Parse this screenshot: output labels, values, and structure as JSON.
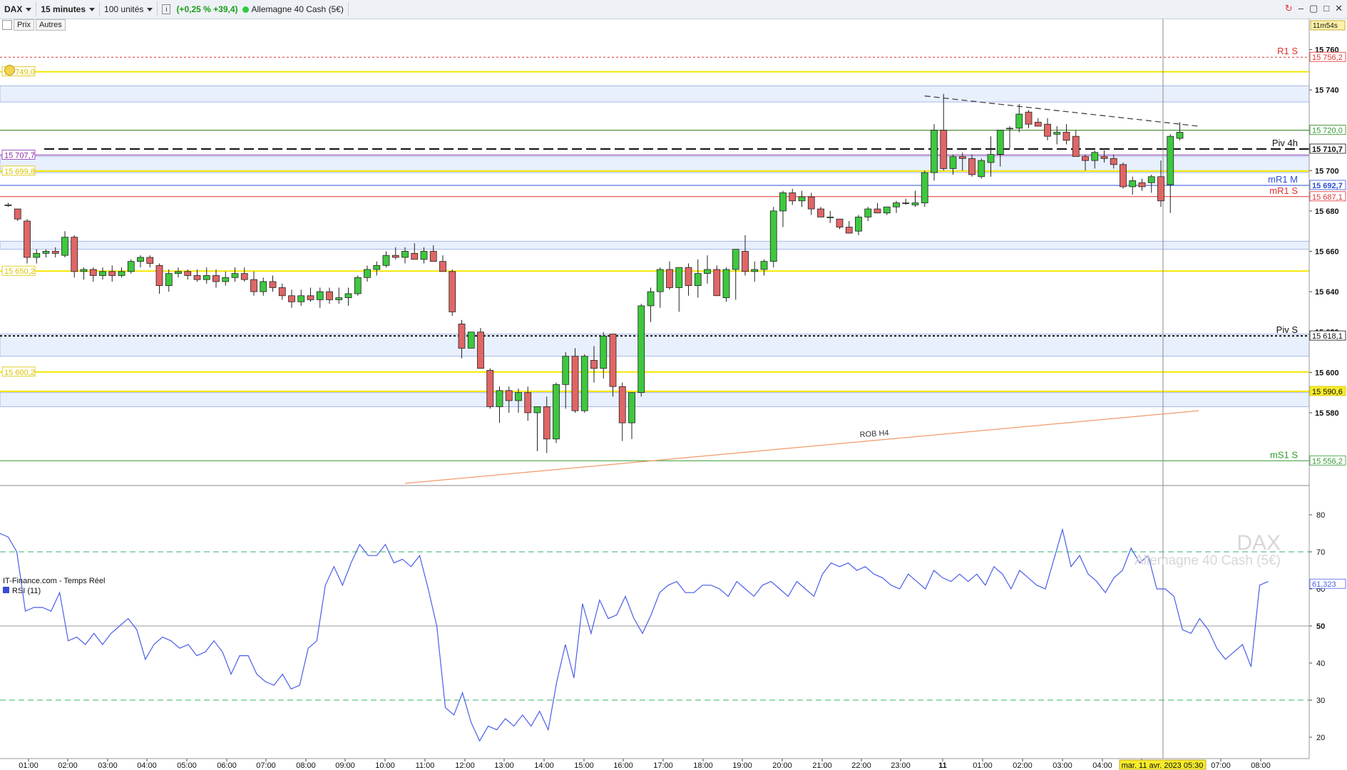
{
  "toolbar": {
    "symbol": "DAX",
    "timeframe": "15 minutes",
    "units": "100 unités",
    "info_icon": "info-icon",
    "change": "(+0,25 % +39,4)",
    "instrument": "Allemagne 40 Cash (5€)",
    "window_controls": [
      "refresh-icon",
      "minimize-icon",
      "restore-icon",
      "maximize-icon",
      "close-icon"
    ]
  },
  "subbar": {
    "prix": "Prix",
    "autres": "Autres"
  },
  "colors": {
    "up": "#3ec83e",
    "down": "#e06666",
    "yellow_line": "#f2e600",
    "blue_zone": "#e8f0fd",
    "red_line": "#e03030",
    "green_line": "#2f9a2f",
    "purple_line": "#8a2fa8",
    "rsi_line": "#4a5ee8"
  },
  "chart_data": [
    {
      "type": "candlestick",
      "title": "DAX",
      "watermark": [
        "DAX",
        "Allemagne 40 Cash (5€)"
      ],
      "source": "IT-Finance.com - Temps Réel",
      "countdown": "11m54s",
      "x_ticks": [
        "01:00",
        "02:00",
        "03:00",
        "04:00",
        "05:00",
        "06:00",
        "07:00",
        "08:00",
        "09:00",
        "10:00",
        "11:00",
        "12:00",
        "13:00",
        "14:00",
        "15:00",
        "16:00",
        "17:00",
        "18:00",
        "19:00",
        "20:00",
        "21:00",
        "22:00",
        "23:00",
        "11",
        "01:00",
        "02:00",
        "03:00",
        "04:00",
        "05:00",
        "07:00",
        "08:00"
      ],
      "crosshair_time": "mar. 11 avr. 2023 05:30",
      "y_ticks": [
        15580,
        15600,
        15620,
        15640,
        15660,
        15680,
        15700,
        15720,
        15740,
        15760
      ],
      "y_tick_labels": [
        "15 580",
        "15 600",
        "15 620",
        "15 640",
        "15 660",
        "15 680",
        "15 700",
        "15 720",
        "15 740",
        "15 760"
      ],
      "ylim": [
        15545,
        15775
      ],
      "candles": [
        [
          15683,
          15684,
          15682,
          15683
        ],
        [
          15681,
          15681,
          15675,
          15676
        ],
        [
          15675,
          15676,
          15654,
          15657
        ],
        [
          15657,
          15661,
          15654,
          15659
        ],
        [
          15659,
          15661,
          15657,
          15660
        ],
        [
          15660,
          15662,
          15657,
          15659
        ],
        [
          15658,
          15670,
          15657,
          15667
        ],
        [
          15667,
          15668,
          15647,
          15650
        ],
        [
          15650,
          15652,
          15646,
          15651
        ],
        [
          15651,
          15652,
          15645,
          15648
        ],
        [
          15648,
          15652,
          15646,
          15650
        ],
        [
          15650,
          15653,
          15645,
          15648
        ],
        [
          15648,
          15652,
          15647,
          15650
        ],
        [
          15650,
          15656,
          15649,
          15655
        ],
        [
          15655,
          15658,
          15652,
          15657
        ],
        [
          15657,
          15658,
          15652,
          15654
        ],
        [
          15653,
          15654,
          15639,
          15643
        ],
        [
          15643,
          15651,
          15640,
          15649
        ],
        [
          15649,
          15652,
          15647,
          15650
        ],
        [
          15650,
          15651,
          15646,
          15648
        ],
        [
          15648,
          15651,
          15645,
          15646
        ],
        [
          15646,
          15652,
          15644,
          15648
        ],
        [
          15648,
          15651,
          15642,
          15645
        ],
        [
          15645,
          15650,
          15643,
          15647
        ],
        [
          15647,
          15652,
          15645,
          15649
        ],
        [
          15649,
          15652,
          15645,
          15646
        ],
        [
          15646,
          15650,
          15638,
          15640
        ],
        [
          15640,
          15647,
          15638,
          15645
        ],
        [
          15645,
          15648,
          15640,
          15642
        ],
        [
          15642,
          15644,
          15636,
          15638
        ],
        [
          15638,
          15641,
          15632,
          15635
        ],
        [
          15635,
          15641,
          15633,
          15638
        ],
        [
          15638,
          15642,
          15635,
          15636
        ],
        [
          15636,
          15642,
          15632,
          15640
        ],
        [
          15640,
          15642,
          15634,
          15636
        ],
        [
          15636,
          15642,
          15634,
          15637
        ],
        [
          15637,
          15642,
          15633,
          15639
        ],
        [
          15639,
          15648,
          15638,
          15647
        ],
        [
          15647,
          15653,
          15645,
          15651
        ],
        [
          15651,
          15655,
          15648,
          15653
        ],
        [
          15653,
          15660,
          15652,
          15658
        ],
        [
          15658,
          15662,
          15656,
          15657
        ],
        [
          15657,
          15662,
          15654,
          15660
        ],
        [
          15659,
          15664,
          15656,
          15656
        ],
        [
          15656,
          15662,
          15654,
          15660
        ],
        [
          15660,
          15663,
          15656,
          15655
        ],
        [
          15655,
          15658,
          15650,
          15650
        ],
        [
          15650,
          15651,
          15628,
          15630
        ],
        [
          15624,
          15626,
          15607,
          15612
        ],
        [
          15612,
          15620,
          15612,
          15620
        ],
        [
          15620,
          15622,
          15608,
          15602
        ],
        [
          15601,
          15602,
          15582,
          15583
        ],
        [
          15583,
          15593,
          15575,
          15591
        ],
        [
          15591,
          15593,
          15580,
          15586
        ],
        [
          15586,
          15592,
          15580,
          15590
        ],
        [
          15590,
          15593,
          15576,
          15580
        ],
        [
          15580,
          15582,
          15561,
          15583
        ],
        [
          15583,
          15588,
          15560,
          15567
        ],
        [
          15567,
          15595,
          15565,
          15594
        ],
        [
          15594,
          15610,
          15582,
          15608
        ],
        [
          15608,
          15612,
          15580,
          15581
        ],
        [
          15581,
          15609,
          15580,
          15608
        ],
        [
          15606,
          15613,
          15595,
          15602
        ],
        [
          15602,
          15620,
          15597,
          15618
        ],
        [
          15619,
          15619,
          15588,
          15593
        ],
        [
          15593,
          15595,
          15566,
          15575
        ],
        [
          15575,
          15590,
          15567,
          15590
        ],
        [
          15590,
          15634,
          15588,
          15633
        ],
        [
          15633,
          15642,
          15625,
          15640
        ],
        [
          15640,
          15652,
          15632,
          15651
        ],
        [
          15651,
          15655,
          15641,
          15642
        ],
        [
          15642,
          15652,
          15630,
          15652
        ],
        [
          15652,
          15654,
          15638,
          15643
        ],
        [
          15643,
          15656,
          15637,
          15649
        ],
        [
          15649,
          15658,
          15644,
          15651
        ],
        [
          15651,
          15653,
          15640,
          15638
        ],
        [
          15637,
          15652,
          15635,
          15651
        ],
        [
          15651,
          15661,
          15636,
          15661
        ],
        [
          15660,
          15668,
          15648,
          15650
        ],
        [
          15650,
          15655,
          15645,
          15651
        ],
        [
          15651,
          15656,
          15648,
          15655
        ],
        [
          15655,
          15682,
          15652,
          15680
        ],
        [
          15680,
          15690,
          15672,
          15689
        ],
        [
          15689,
          15691,
          15683,
          15685
        ],
        [
          15685,
          15690,
          15682,
          15687
        ],
        [
          15687,
          15689,
          15678,
          15681
        ],
        [
          15681,
          15682,
          15677,
          15677
        ],
        [
          15677,
          15680,
          15674,
          15677
        ],
        [
          15676,
          15676,
          15671,
          15672
        ],
        [
          15672,
          15675,
          15670,
          15669
        ],
        [
          15670,
          15678,
          15668,
          15677
        ],
        [
          15677,
          15682,
          15675,
          15681
        ],
        [
          15681,
          15684,
          15679,
          15679
        ],
        [
          15679,
          15681,
          15678,
          15682
        ],
        [
          15682,
          15685,
          15679,
          15684
        ],
        [
          15684,
          15686,
          15683,
          15684
        ],
        [
          15683,
          15690,
          15682,
          15684
        ],
        [
          15684,
          15700,
          15682,
          15699
        ],
        [
          15699,
          15723,
          15695,
          15720
        ],
        [
          15720,
          15738,
          15700,
          15701
        ],
        [
          15701,
          15708,
          15698,
          15707
        ],
        [
          15707,
          15709,
          15700,
          15706
        ],
        [
          15706,
          15708,
          15697,
          15698
        ],
        [
          15697,
          15706,
          15696,
          15705
        ],
        [
          15704,
          15717,
          15697,
          15708
        ],
        [
          15708,
          15720,
          15702,
          15720
        ],
        [
          15721,
          15722,
          15711,
          15721
        ],
        [
          15721,
          15733,
          15719,
          15728
        ],
        [
          15729,
          15730,
          15721,
          15723
        ],
        [
          15724,
          15726,
          15722,
          15722
        ],
        [
          15723,
          15726,
          15715,
          15717
        ],
        [
          15718,
          15722,
          15713,
          15719
        ],
        [
          15719,
          15723,
          15713,
          15715
        ],
        [
          15717,
          15720,
          15708,
          15707
        ],
        [
          15707,
          15708,
          15700,
          15705
        ],
        [
          15705,
          15710,
          15701,
          15709
        ],
        [
          15707,
          15710,
          15704,
          15706
        ],
        [
          15706,
          15708,
          15701,
          15703
        ],
        [
          15703,
          15704,
          15691,
          15692
        ],
        [
          15692,
          15697,
          15688,
          15695
        ],
        [
          15694,
          15696,
          15690,
          15692
        ],
        [
          15694,
          15698,
          15689,
          15697
        ],
        [
          15697,
          15705,
          15682,
          15685
        ],
        [
          15693,
          15718,
          15679,
          15717
        ],
        [
          15716,
          15724,
          15715,
          15719
        ]
      ],
      "hlines": [
        {
          "label": "R1 S",
          "value": 15756.2,
          "badge": "15 756,2",
          "color": "#e03030",
          "style": "dotted"
        },
        {
          "label": "",
          "value": 15749.0,
          "badge": "15 749,0",
          "color": "#f2e600",
          "style": "solid",
          "side": "left"
        },
        {
          "label": "",
          "value": 15720.0,
          "badge": "15 720,0",
          "color": "#e03030",
          "style": "solid"
        },
        {
          "label": "",
          "value": 15720.0,
          "badge": "15 720,0",
          "color": "#2f9a2f",
          "style": "solid"
        },
        {
          "label": "Piv 4h",
          "value": 15710.7,
          "badge": "15 710,7",
          "color": "#111111",
          "style": "dashed"
        },
        {
          "label": "",
          "value": 15707.7,
          "badge": "15 707,7",
          "color": "#8a2fa8",
          "style": "solid",
          "side": "left"
        },
        {
          "label": "",
          "value": 15699.8,
          "badge": "15 699,8",
          "color": "#f2e600",
          "style": "solid",
          "side": "left"
        },
        {
          "label": "mR1 M",
          "value": 15692.7,
          "badge": "15 692,7",
          "color": "#2b4fd8",
          "style": "solid"
        },
        {
          "label": "mR1 S",
          "value": 15687.1,
          "badge": "15 687,1",
          "color": "#e03030",
          "style": "solid"
        },
        {
          "label": "",
          "value": 15650.2,
          "badge": "15 650,2",
          "color": "#f2e600",
          "style": "solid",
          "side": "left"
        },
        {
          "label": "Piv S",
          "value": 15618.1,
          "badge": "15 618,1",
          "color": "#111111",
          "style": "dotted"
        },
        {
          "label": "",
          "value": 15600.2,
          "badge": "15 600,2",
          "color": "#f2e600",
          "style": "solid",
          "side": "left"
        },
        {
          "label": "",
          "value": 15590.6,
          "badge": "15 590,6",
          "color": "#f2e600",
          "style": "solid"
        },
        {
          "label": "mS1 S",
          "value": 15556.2,
          "badge": "15 556,2",
          "color": "#2f9a2f",
          "style": "solid"
        }
      ],
      "zones": [
        [
          15734,
          15742
        ],
        [
          15699,
          15707
        ],
        [
          15661,
          15665
        ],
        [
          15608,
          15619
        ],
        [
          15583,
          15590
        ]
      ],
      "trendlines": [
        {
          "label": "",
          "points": [
            [
              97,
              15737
            ],
            [
              126,
              15722
            ]
          ],
          "style": "dashed",
          "color": "#444444"
        },
        {
          "label": "ROB H4",
          "points": [
            [
              42,
              15545
            ],
            [
              126,
              15581
            ]
          ],
          "style": "solid",
          "color": "#f29a6a"
        }
      ]
    },
    {
      "type": "line",
      "title": "RSI (11)",
      "last_value": "61,323",
      "ylim": [
        15,
        85
      ],
      "y_ticks": [
        20,
        30,
        40,
        50,
        60,
        70,
        80
      ],
      "levels": [
        30,
        50,
        70
      ],
      "values": [
        75,
        74,
        70,
        54,
        55,
        55,
        54,
        59,
        46,
        47,
        45,
        48,
        45,
        48,
        50,
        52,
        49,
        41,
        45,
        47,
        46,
        44,
        45,
        42,
        43,
        46,
        43,
        37,
        42,
        42,
        37,
        35,
        34,
        37,
        33,
        34,
        44,
        46,
        61,
        66,
        61,
        67,
        72,
        69,
        69,
        72,
        67,
        68,
        66,
        69,
        60,
        50,
        28,
        26,
        32,
        24,
        19,
        23,
        22,
        25,
        23,
        26,
        23,
        27,
        22,
        35,
        45,
        36,
        56,
        48,
        57,
        52,
        53,
        58,
        52,
        48,
        53,
        59,
        61,
        62,
        59,
        59,
        61,
        61,
        60,
        58,
        62,
        60,
        58,
        61,
        62,
        60,
        58,
        62,
        60,
        58,
        64,
        67,
        66,
        67,
        65,
        66,
        64,
        63,
        61,
        60,
        64,
        62,
        60,
        65,
        63,
        62,
        64,
        62,
        64,
        61,
        66,
        64,
        60,
        65,
        63,
        61,
        60,
        68,
        76,
        66,
        69,
        64,
        62,
        59,
        63,
        65,
        71,
        67,
        69,
        60,
        60,
        58,
        49,
        48,
        52,
        49,
        44,
        41,
        43,
        45,
        39,
        61,
        62
      ]
    }
  ]
}
